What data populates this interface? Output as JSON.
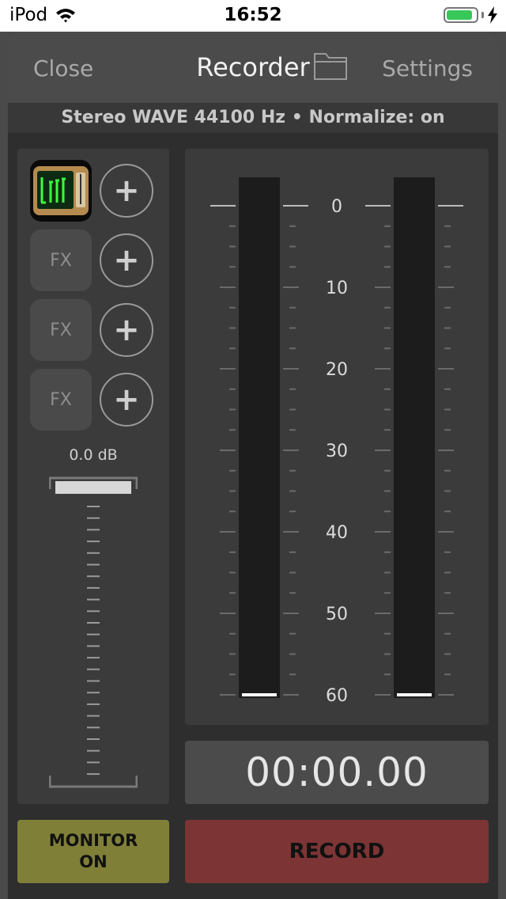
{
  "status_bar": {
    "carrier": "iPod",
    "time": "16:52",
    "battery_level": 0.9,
    "icons": [
      "wifi-icon",
      "battery-icon",
      "charging-bolt-icon"
    ]
  },
  "navbar": {
    "close_label": "Close",
    "title": "Recorder",
    "settings_label": "Settings",
    "folder_icon": "folder-icon"
  },
  "info": {
    "format": "Stereo WAVE 44100 Hz • Normalize: on"
  },
  "effects": {
    "slots": [
      {
        "type": "plugin",
        "icon": "plugin-thumbnail"
      },
      {
        "type": "empty",
        "label": "FX"
      },
      {
        "type": "empty",
        "label": "FX"
      },
      {
        "type": "empty",
        "label": "FX"
      }
    ],
    "add_symbol": "+"
  },
  "gain": {
    "label": "0.0 dB",
    "level": 1.0
  },
  "meter": {
    "scale_labels": [
      "0",
      "10",
      "20",
      "30",
      "40",
      "50",
      "60"
    ],
    "left_level": 0,
    "right_level": 0
  },
  "timer": {
    "value": "00:00.00"
  },
  "buttons": {
    "monitor_line1": "MONITOR",
    "monitor_line2": "ON",
    "record": "RECORD"
  },
  "colors": {
    "monitor_bg": "#7f7f38",
    "record_bg": "#7d3434",
    "battery_fill": "#38c759"
  }
}
